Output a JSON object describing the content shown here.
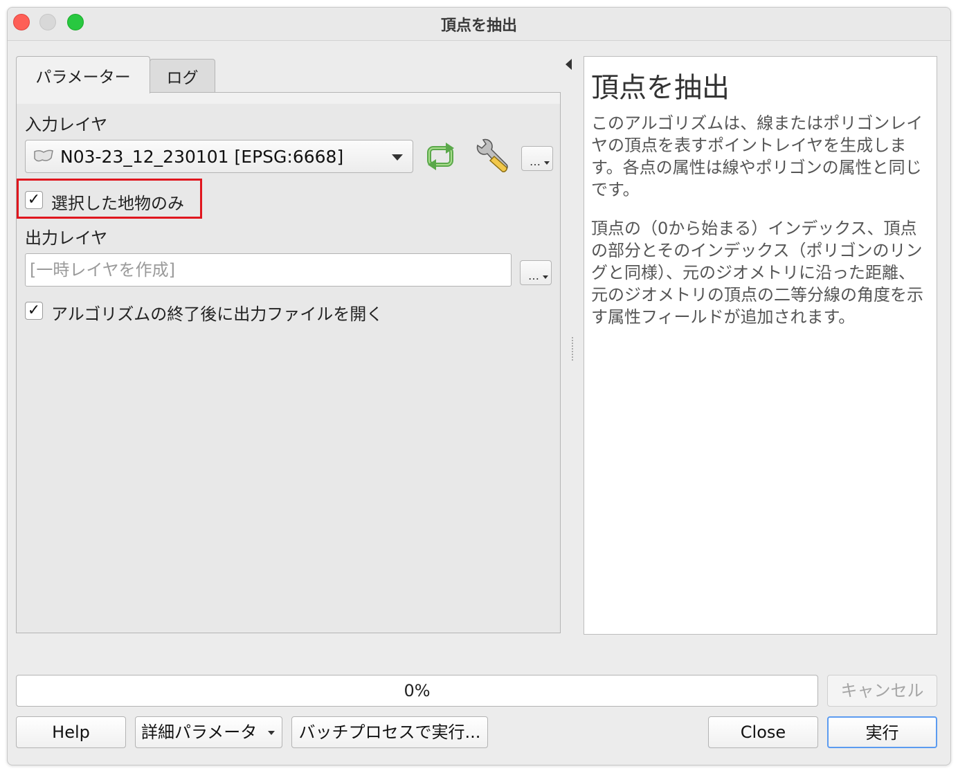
{
  "window": {
    "title": "頂点を抽出"
  },
  "tabs": [
    {
      "label": "パラメーター",
      "active": true
    },
    {
      "label": "ログ",
      "active": false
    }
  ],
  "params": {
    "input_layer_label": "入力レイヤ",
    "input_layer_value": "N03-23_12_230101 [EPSG:6668]",
    "selected_only_label": "選択した地物のみ",
    "selected_only_checked": true,
    "output_layer_label": "出力レイヤ",
    "output_layer_placeholder": "[一時レイヤを作成]",
    "open_output_label": "アルゴリズムの終了後に出力ファイルを開く",
    "open_output_checked": true,
    "dots_label": "…"
  },
  "help": {
    "title": "頂点を抽出",
    "paragraph1": "このアルゴリズムは、線またはポリゴンレイヤの頂点を表すポイントレイヤを生成します。各点の属性は線やポリゴンの属性と同じです。",
    "paragraph2": "頂点の（0から始まる）インデックス、頂点の部分とそのインデックス（ポリゴンのリングと同様）、元のジオメトリに沿った距離、元のジオメトリの頂点の二等分線の角度を示す属性フィールドが追加されます。"
  },
  "progress": {
    "text": "0%",
    "value": 0
  },
  "buttons": {
    "cancel": "キャンセル",
    "help": "Help",
    "advanced": "詳細パラメータ",
    "batch": "バッチプロセスで実行...",
    "close": "Close",
    "run": "実行"
  },
  "icons": {
    "polygon_layer": "polygon-layer-icon",
    "iterate": "iterate-icon",
    "wrench": "wrench-icon"
  },
  "colors": {
    "highlight": "#e0161e",
    "primary_border": "#5b9bf0",
    "iterate_green": "#5aa84a"
  }
}
